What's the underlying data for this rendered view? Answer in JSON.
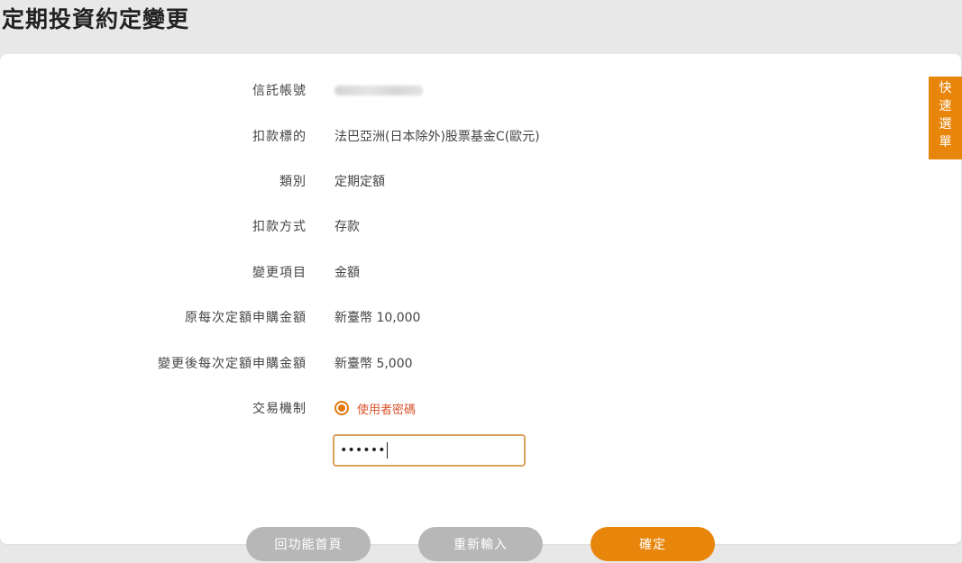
{
  "page": {
    "title": "定期投資約定變更"
  },
  "form": {
    "rows": [
      {
        "label": "信託帳號",
        "value": ""
      },
      {
        "label": "扣款標的",
        "value": "法巴亞洲(日本除外)股票基金C(歐元)"
      },
      {
        "label": "類別",
        "value": "定期定額"
      },
      {
        "label": "扣款方式",
        "value": "存款"
      },
      {
        "label": "變更項目",
        "value": "金額"
      },
      {
        "label": "原每次定額申購金額",
        "value": "新臺幣 10,000"
      },
      {
        "label": "變更後每次定額申購金額",
        "value": "新臺幣 5,000"
      },
      {
        "label": "交易機制",
        "value": ""
      }
    ],
    "mechanism_option": "使用者密碼",
    "password_display": "••••••"
  },
  "quick_menu": {
    "chars": [
      "快",
      "速",
      "選",
      "單"
    ]
  },
  "buttons": {
    "home": "回功能首頁",
    "reset": "重新輸入",
    "confirm": "確定"
  },
  "colors": {
    "accent": "#e8860c",
    "button_gray": "#b7b7b7",
    "radio_text": "#d9522b"
  }
}
